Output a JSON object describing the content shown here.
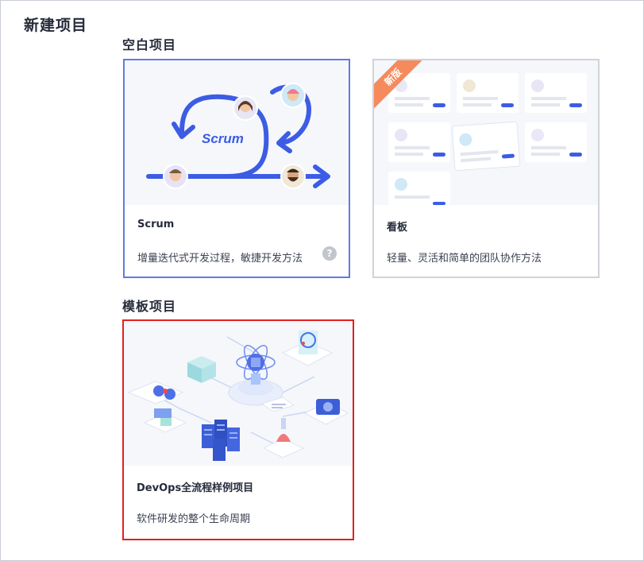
{
  "page": {
    "title": "新建项目"
  },
  "sections": {
    "blank": {
      "title": "空白项目"
    },
    "template": {
      "title": "模板项目"
    }
  },
  "cards": {
    "scrum": {
      "name": "Scrum",
      "description": "增量迭代式开发过程，敏捷开发方法",
      "illustration_text": "Scrum",
      "help_icon": "?"
    },
    "kanban": {
      "name": "看板",
      "description": "轻量、灵活和简单的团队协作方法",
      "badge": "新版"
    },
    "devops": {
      "name": "DevOps全流程样例项目",
      "description": "软件研发的整个生命周期"
    }
  },
  "colors": {
    "selected_border": "#5e7ce0",
    "highlight_border": "#e02020",
    "accent_blue": "#3d5ce5",
    "badge_orange": "#f58a5c"
  }
}
